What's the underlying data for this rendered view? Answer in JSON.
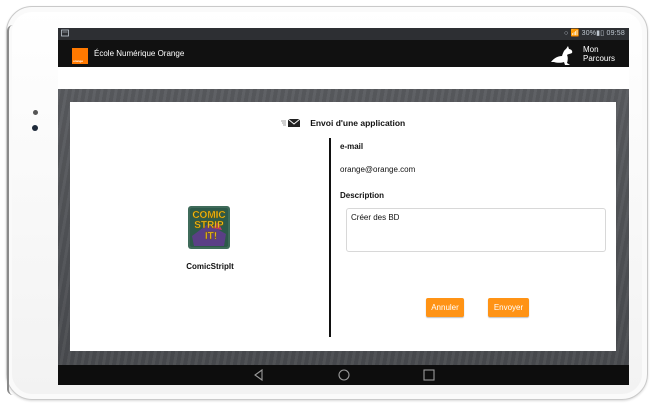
{
  "status_bar": {
    "right_text": "○ 📶 30%▮▯ 09:58"
  },
  "app_bar": {
    "logo_text": "orange",
    "title": "École Numérique Orange",
    "parcours_line1": "Mon",
    "parcours_line2": "Parcours"
  },
  "dialog": {
    "title": "Envoi d'une application",
    "app_name": "ComicStripIt",
    "email_label": "e-mail",
    "email_value": "orange@orange.com",
    "description_label": "Description",
    "description_value": "Créer des BD",
    "cancel_label": "Annuler",
    "send_label": "Envoyer"
  },
  "colors": {
    "accent": "#ff9315",
    "brand_orange": "#ff7900"
  },
  "icons": [
    "mail-icon",
    "comic-strip-it-icon",
    "kangaroo-icon",
    "back-icon",
    "home-icon",
    "recents-icon"
  ]
}
